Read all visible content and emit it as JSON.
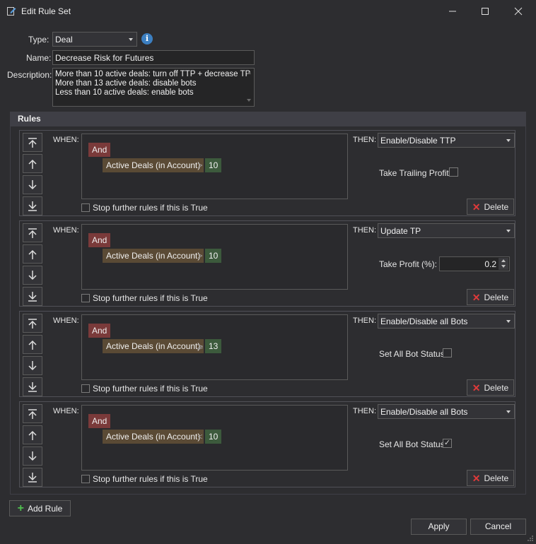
{
  "window": {
    "title": "Edit Rule Set"
  },
  "form": {
    "type_label": "Type:",
    "type_value": "Deal",
    "name_label": "Name:",
    "name_value": "Decrease Risk for Futures",
    "description_label": "Description:",
    "description_lines": [
      "More than 10 active deals: turn off TTP + decrease TP",
      "More than 13 active deals: disable bots",
      "Less than 10 active deals: enable bots"
    ]
  },
  "rules_title": "Rules",
  "rules": [
    {
      "when_label": "WHEN:",
      "and_label": "And",
      "condition": {
        "variable": "Active Deals (in Account)",
        "operator": ">",
        "value": "10"
      },
      "stop_label": "Stop further rules if this is True",
      "stop_checked": false,
      "then_label": "THEN:",
      "action": "Enable/Disable TTP",
      "param": {
        "kind": "checkbox",
        "label": "Take Trailing Profit:",
        "checked": false
      },
      "delete_label": "Delete"
    },
    {
      "when_label": "WHEN:",
      "and_label": "And",
      "condition": {
        "variable": "Active Deals (in Account)",
        "operator": ">",
        "value": "10"
      },
      "stop_label": "Stop further rules if this is True",
      "stop_checked": false,
      "then_label": "THEN:",
      "action": "Update TP",
      "param": {
        "kind": "number",
        "label": "Take Profit (%):",
        "value": "0.2"
      },
      "delete_label": "Delete"
    },
    {
      "when_label": "WHEN:",
      "and_label": "And",
      "condition": {
        "variable": "Active Deals (in Account)",
        "operator": "⩾",
        "value": "13"
      },
      "stop_label": "Stop further rules if this is True",
      "stop_checked": false,
      "then_label": "THEN:",
      "action": "Enable/Disable all Bots",
      "param": {
        "kind": "checkbox",
        "label": "Set All Bot Status:",
        "checked": false
      },
      "delete_label": "Delete"
    },
    {
      "when_label": "WHEN:",
      "and_label": "And",
      "condition": {
        "variable": "Active Deals (in Account)",
        "operator": "<",
        "value": "10"
      },
      "stop_label": "Stop further rules if this is True",
      "stop_checked": false,
      "then_label": "THEN:",
      "action": "Enable/Disable all Bots",
      "param": {
        "kind": "checkbox",
        "label": "Set All Bot Status:",
        "checked": true
      },
      "delete_label": "Delete"
    }
  ],
  "buttons": {
    "add_rule": "Add Rule",
    "apply": "Apply",
    "cancel": "Cancel"
  },
  "colors": {
    "background": "#2d2d30",
    "and_tag": "#7a3a3a",
    "variable_tag": "#5a4a35",
    "value_tag": "#3c5a3c",
    "info": "#3c7fc1",
    "delete_x": "#e03a3a",
    "add_plus": "#4fbf4f"
  }
}
